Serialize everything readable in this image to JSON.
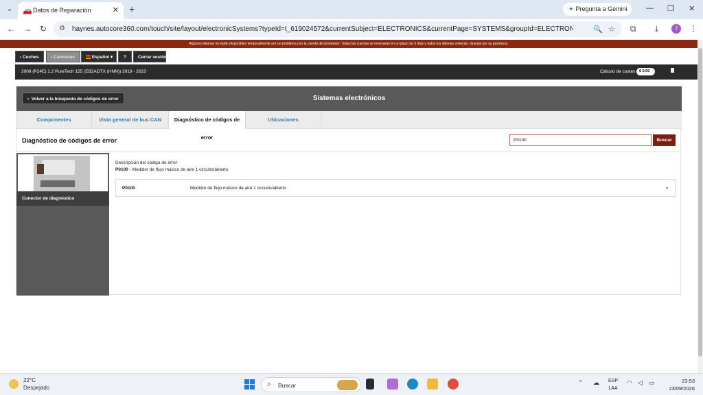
{
  "browser": {
    "tab_title": "Datos de Reparación",
    "tab_icon": "car-icon",
    "gemini_label": "Pregunta a Gemini",
    "url": "haynes.autocore360.com/touch/site/layout/electronicSystems?typeId=t_619024572&currentSubject=ELECTRONICS&currentPage=SYSTEMS&groupId=ELECTRONICS&faultCodes=P...",
    "profile_initial": "J"
  },
  "notice": "Algunos idiomas no están disponibles temporalmente por un problema con la cuenta del proveedor. Todas las cuentas se renovarán en un plazo de 3 días y todos los idiomas volverán. Gracias por su paciencia.",
  "topnav": {
    "cars": "Coches",
    "trucks": "Camiones",
    "language": "Español",
    "help": "?",
    "logout": "Cerrar sesión"
  },
  "vehicle": {
    "description": "2008 (P24E) 1.2 PureTech 155 (EB2ADTX (HNN)) 2019 - 2023",
    "cost_label": "Cálculo de costes",
    "cost_currency": "€",
    "cost_value": "0,00"
  },
  "panel": {
    "back_label": "Volver a la búsqueda de códigos de error",
    "title": "Sistemas electrónicos",
    "tabs": [
      "Componentes",
      "Vista general de bus CAN",
      "Diagnóstico de códigos de error",
      "Ubicaciones"
    ],
    "active_tab": 2,
    "section_title": "Diagnóstico de códigos de error",
    "search_value": "P0100",
    "search_button": "Buscar",
    "sidebar_label": "Conector de diagnóstico",
    "desc_label": "Descripción del código de error:",
    "desc_code": "P0100",
    "desc_text": " - Medidor de flujo másico de aire 1 circuito/abierto",
    "rows": [
      {
        "code": "P0100",
        "description": "Medidor de flujo másico de aire 1 circuito/abierto"
      }
    ]
  },
  "taskbar": {
    "temperature": "22°C",
    "weather": "Despejado",
    "search_placeholder": "Buscar",
    "lang_1": "ESP",
    "lang_2": "LAA",
    "time": "23:53",
    "date": "23/09/2026"
  }
}
